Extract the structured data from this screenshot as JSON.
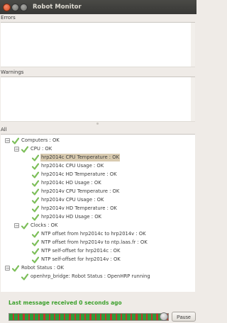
{
  "window": {
    "title": "Robot Monitor"
  },
  "errors": {
    "label": "Errors"
  },
  "warnings": {
    "label": "Warnings"
  },
  "all": {
    "label": "All"
  },
  "tree": [
    {
      "label": "Computers : OK",
      "level": 0,
      "expander": "−",
      "status": "ok"
    },
    {
      "label": "CPU : OK",
      "level": 1,
      "expander": "−",
      "status": "ok"
    },
    {
      "label": "hrp2014c CPU Temperature : OK",
      "level": 2,
      "status": "ok",
      "selected": true
    },
    {
      "label": "hrp2014c CPU Usage : OK",
      "level": 2,
      "status": "ok"
    },
    {
      "label": "hrp2014c HD Temperature : OK",
      "level": 2,
      "status": "ok"
    },
    {
      "label": "hrp2014c HD Usage : OK",
      "level": 2,
      "status": "ok"
    },
    {
      "label": "hrp2014v CPU Temperature : OK",
      "level": 2,
      "status": "ok"
    },
    {
      "label": "hrp2014v CPU Usage : OK",
      "level": 2,
      "status": "ok"
    },
    {
      "label": "hrp2014v HD Temperature : OK",
      "level": 2,
      "status": "ok"
    },
    {
      "label": "hrp2014v HD Usage : OK",
      "level": 2,
      "status": "ok"
    },
    {
      "label": "Clocks : OK",
      "level": 1,
      "expander": "−",
      "status": "ok"
    },
    {
      "label": "NTP offset from hrp2014c to hrp2014v : OK",
      "level": 2,
      "status": "ok"
    },
    {
      "label": "NTP offset from hrp2014v to ntp.laas.fr : OK",
      "level": 2,
      "status": "ok"
    },
    {
      "label": "NTP self-offset for hrp2014c : OK",
      "level": 2,
      "status": "ok"
    },
    {
      "label": "NTP self-offset for hrp2014v : OK",
      "level": 2,
      "status": "ok"
    },
    {
      "label": "Robot Status : OK",
      "level": 0,
      "expander": "−",
      "status": "ok"
    },
    {
      "label": "openhrp_bridge: Robot Status : OpenHRP running",
      "level": 1,
      "status": "ok"
    }
  ],
  "status": {
    "last_message": "Last message received 0 seconds ago"
  },
  "timeline": {
    "tick_count": 31,
    "colors": {
      "ok": "#2f9b3a",
      "error": "#c0392b"
    }
  },
  "pause_button": {
    "label": "Pause"
  },
  "colors": {
    "ok_text": "#3fa12f",
    "selection": "#d9cbb0",
    "titlebar": "#3c3b37"
  }
}
